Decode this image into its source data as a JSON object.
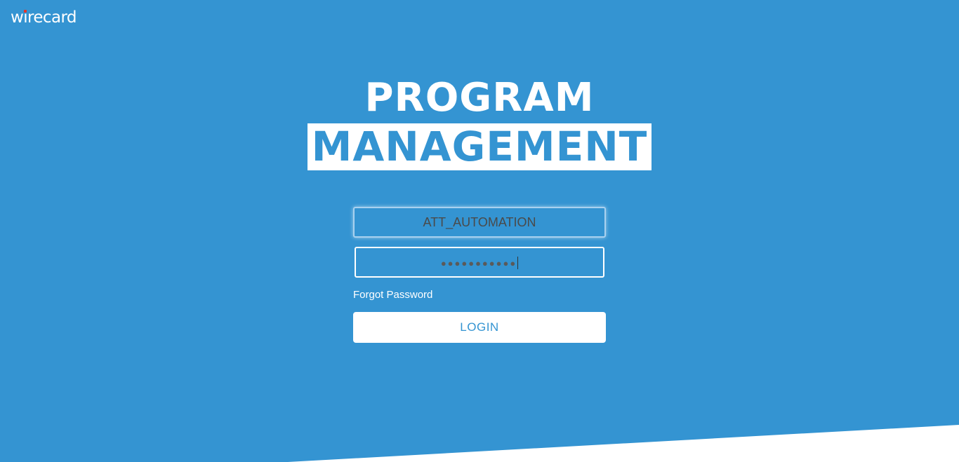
{
  "brand": {
    "logo_prefix": "w",
    "logo_i": "i",
    "logo_suffix": "recard"
  },
  "title": {
    "line1": "PROGRAM",
    "line2": "MANAGEMENT"
  },
  "form": {
    "username_value": "ATT_AUTOMATION",
    "password_value": "●●●●●●●●●●●",
    "forgot_label": "Forgot Password",
    "login_label": "LOGIN"
  },
  "colors": {
    "background": "#3494d2",
    "foreground": "#ffffff",
    "logo_accent": "#e4352b"
  }
}
